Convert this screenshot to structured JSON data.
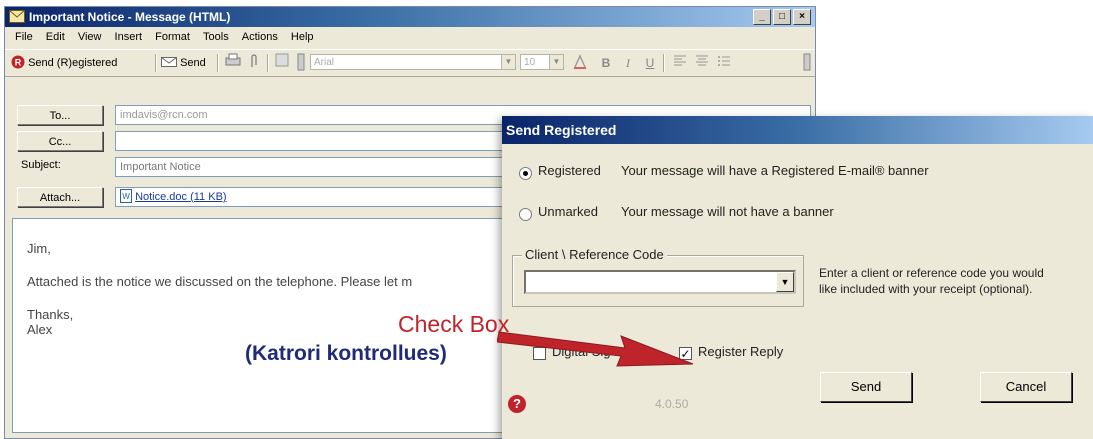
{
  "outlook": {
    "title": "Important Notice - Message (HTML)",
    "window_buttons": [
      "_",
      "□",
      "×"
    ],
    "menu": [
      "File",
      "Edit",
      "View",
      "Insert",
      "Format",
      "Tools",
      "Actions",
      "Help"
    ],
    "toolbar": {
      "send_registered": "Send (R)egistered",
      "send": "Send",
      "font": "Arial",
      "size": "10",
      "bold": "B",
      "italic": "I",
      "underline": "U"
    },
    "to_button": "To...",
    "to_value": "imdavis@rcn.com",
    "cc_button": "Cc...",
    "cc_value": "",
    "subject_label": "Subject:",
    "subject_value": "Important Notice",
    "attach_button": "Attach...",
    "attachment": "Notice.doc (11 KB)",
    "body_lines": [
      "Jim,",
      "Attached is the notice we discussed on the telephone.  Please let m",
      "Thanks,",
      "Alex"
    ]
  },
  "dialog": {
    "title": "Send Registered",
    "registered_label": "Registered",
    "registered_desc": "Your message will have a Registered E-mail® banner",
    "unmarked_label": "Unmarked",
    "unmarked_desc": "Your message will not have a banner",
    "group_caption": "Client \\ Reference Code",
    "client_code_value": "",
    "client_help_1": "Enter a client or reference code you would",
    "client_help_2": "like included with your receipt (optional).",
    "digital_sig_label": "Digital Sig",
    "register_reply_label": "Register Reply",
    "register_reply_checked": true,
    "version": "4.0.50",
    "send_button": "Send",
    "cancel_button": "Cancel"
  },
  "annotation": {
    "line1": "Check Box",
    "line2": "(Katrori kontrollues)",
    "color1": "#c0242b",
    "color2": "#1f2a78"
  }
}
